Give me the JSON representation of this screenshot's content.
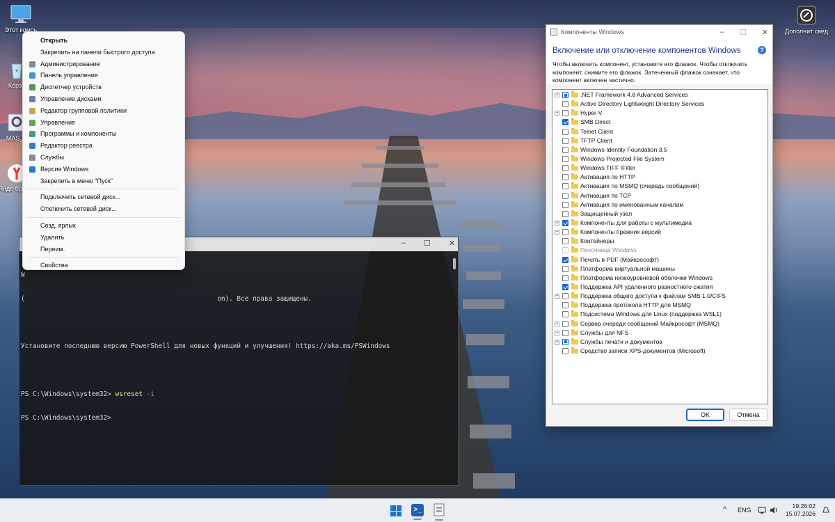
{
  "desktop": {
    "icons": [
      {
        "label": "Этот компь",
        "icon": "computer-icon"
      },
      {
        "label": "Корзи",
        "icon": "recycle-bin-icon"
      },
      {
        "label": "MAS_A",
        "icon": "gear-icon"
      },
      {
        "label": "Янде браузе",
        "icon": "yandex-browser-icon"
      },
      {
        "label": "Дополнит сведения",
        "icon": "info-icon"
      }
    ]
  },
  "context_menu": {
    "items": [
      {
        "label": "Открыть",
        "bold": true,
        "icon": ""
      },
      {
        "label": "Закрепить на панели быстрого доступа",
        "icon": ""
      },
      {
        "label": "Администрирование",
        "icon": "admin-tools-icon"
      },
      {
        "label": "Панель управления",
        "icon": "control-panel-icon"
      },
      {
        "label": "Диспетчер устройств",
        "icon": "device-manager-icon"
      },
      {
        "label": "Управление дисками",
        "icon": "disk-management-icon"
      },
      {
        "label": "Редактор групповой политики",
        "icon": "group-policy-icon"
      },
      {
        "label": "Управление",
        "icon": "computer-management-icon"
      },
      {
        "label": "Программы и компоненты",
        "icon": "programs-icon"
      },
      {
        "label": "Редактор реестра",
        "icon": "registry-icon"
      },
      {
        "label": "Службы",
        "icon": "services-icon"
      },
      {
        "label": "Версия Windows",
        "icon": "windows-info-icon"
      },
      {
        "label": "Закрепить в меню \"Пуск\"",
        "icon": ""
      },
      {
        "label": "Подключить сетевой диск...",
        "icon": "",
        "sep_before": true
      },
      {
        "label": "Отключить сетевой диск...",
        "icon": ""
      },
      {
        "label": "Созд. ярлык",
        "icon": "",
        "sep_before": true
      },
      {
        "label": "Удалить",
        "icon": ""
      },
      {
        "label": "Переим.",
        "icon": ""
      },
      {
        "label": "Свойства",
        "icon": "",
        "sep_before": true
      }
    ]
  },
  "powershell": {
    "lines": [
      {
        "prefix": "W",
        "cmd": "",
        "arg": ""
      },
      {
        "prefix": "(                                                 on). Все права защищены.",
        "cmd": "",
        "arg": ""
      },
      {
        "prefix": "",
        "cmd": "",
        "arg": ""
      },
      {
        "prefix": "Установите последнюю версию PowerShell для новых функций и улучшения! https://aka.ms/PSWindows",
        "cmd": "",
        "arg": ""
      },
      {
        "prefix": "",
        "cmd": "",
        "arg": ""
      },
      {
        "prefix": "PS C:\\Windows\\system32> ",
        "cmd": "wsreset",
        "arg": " -i"
      },
      {
        "prefix": "PS C:\\Windows\\system32>",
        "cmd": "",
        "arg": ""
      }
    ]
  },
  "features_dialog": {
    "window_title": "Компоненты Windows",
    "heading": "Включение или отключение компонентов Windows",
    "description": "Чтобы включить компонент, установите его флажок. Чтобы отключить компонент, снимите его флажок. Затененный флажок означает, что компонент включен частично.",
    "help": "?",
    "ok_label": "OK",
    "cancel_label": "Отмена",
    "features": [
      {
        "label": ".NET Framework 4.8 Advanced Services",
        "state": "partial",
        "expand": true
      },
      {
        "label": "Active Directory Lightweight Directory Services",
        "state": "unchecked",
        "expand": false
      },
      {
        "label": "Hyper-V",
        "state": "unchecked",
        "expand": true
      },
      {
        "label": "SMB Direct",
        "state": "checked",
        "expand": false
      },
      {
        "label": "Telnet Client",
        "state": "unchecked",
        "expand": false
      },
      {
        "label": "TFTP Client",
        "state": "unchecked",
        "expand": false
      },
      {
        "label": "Windows Identity Foundation 3.5",
        "state": "unchecked",
        "expand": false
      },
      {
        "label": "Windows Projected File System",
        "state": "unchecked",
        "expand": false
      },
      {
        "label": "Windows TIFF IFilter",
        "state": "unchecked",
        "expand": false
      },
      {
        "label": "Активация по HTTP",
        "state": "unchecked",
        "expand": false
      },
      {
        "label": "Активация по MSMQ (очередь сообщений)",
        "state": "unchecked",
        "expand": false
      },
      {
        "label": "Активация по TCP",
        "state": "unchecked",
        "expand": false
      },
      {
        "label": "Активация по именованным каналам",
        "state": "unchecked",
        "expand": false
      },
      {
        "label": "Защищенный узел",
        "state": "unchecked",
        "expand": false
      },
      {
        "label": "Компоненты для работы с мультимедиа",
        "state": "checked",
        "expand": true
      },
      {
        "label": "Компоненты прежних версий",
        "state": "unchecked",
        "expand": true
      },
      {
        "label": "Контейнеры",
        "state": "unchecked",
        "expand": false
      },
      {
        "label": "Песочница Windows",
        "state": "disabled",
        "expand": false
      },
      {
        "label": "Печать в PDF (Майкрософт)",
        "state": "checked",
        "expand": false
      },
      {
        "label": "Платформа виртуальной машины",
        "state": "unchecked",
        "expand": false
      },
      {
        "label": "Платформа низкоуровневой оболочки Windows",
        "state": "unchecked",
        "expand": false
      },
      {
        "label": "Поддержка API удаленного разностного сжатия",
        "state": "checked",
        "expand": false
      },
      {
        "label": "Поддержка общего доступа к файлам SMB 1.0/CIFS",
        "state": "unchecked",
        "expand": true
      },
      {
        "label": "Поддержка протокола HTTP для MSMQ",
        "state": "unchecked",
        "expand": false
      },
      {
        "label": "Подсистема Windows для Linux (поддержка WSL1)",
        "state": "unchecked",
        "expand": false
      },
      {
        "label": "Сервер очереди сообщений Майкрософт (MSMQ)",
        "state": "unchecked",
        "expand": true
      },
      {
        "label": "Службы для NFS",
        "state": "unchecked",
        "expand": true
      },
      {
        "label": "Службы печати и документов",
        "state": "partial",
        "expand": true
      },
      {
        "label": "Средство записи XPS-документов (Microsoft)",
        "state": "unchecked",
        "expand": false
      }
    ]
  },
  "taskbar": {
    "language": "ENG",
    "time": "19:26:02",
    "date": "15.07.2026",
    "tray_chevron": "^",
    "apps": [
      "start-button",
      "powershell",
      "windows-features"
    ]
  },
  "colors": {
    "accent": "#1d67c9",
    "heading": "#1f3c8a",
    "folder": "#f2c94c"
  }
}
